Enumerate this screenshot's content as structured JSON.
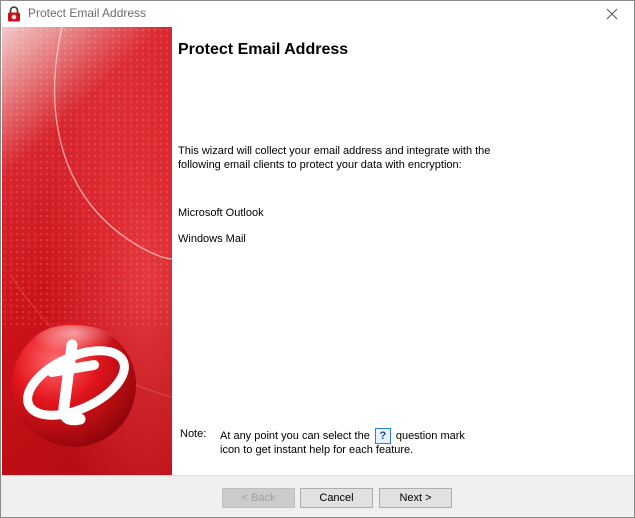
{
  "window": {
    "title": "Protect Email Address"
  },
  "content": {
    "heading": "Protect Email Address",
    "description": "This wizard will collect your email address and integrate with the following email clients to protect your data with encryption:",
    "clients": [
      "Microsoft Outlook",
      "Windows Mail"
    ],
    "note_label": "Note:",
    "note_before": "At any point you can select the",
    "help_icon_label": "?",
    "note_after": "question mark icon to get instant help for each feature."
  },
  "footer": {
    "back_label": "< Back",
    "cancel_label": "Cancel",
    "next_label": "Next >"
  },
  "colors": {
    "brand_red": "#d71920",
    "accent_blue": "#2a7ed8"
  },
  "icons": {
    "title": "trend-micro-lock-icon",
    "close": "close-icon",
    "logo": "trend-micro-logo",
    "help": "help-question-icon"
  }
}
